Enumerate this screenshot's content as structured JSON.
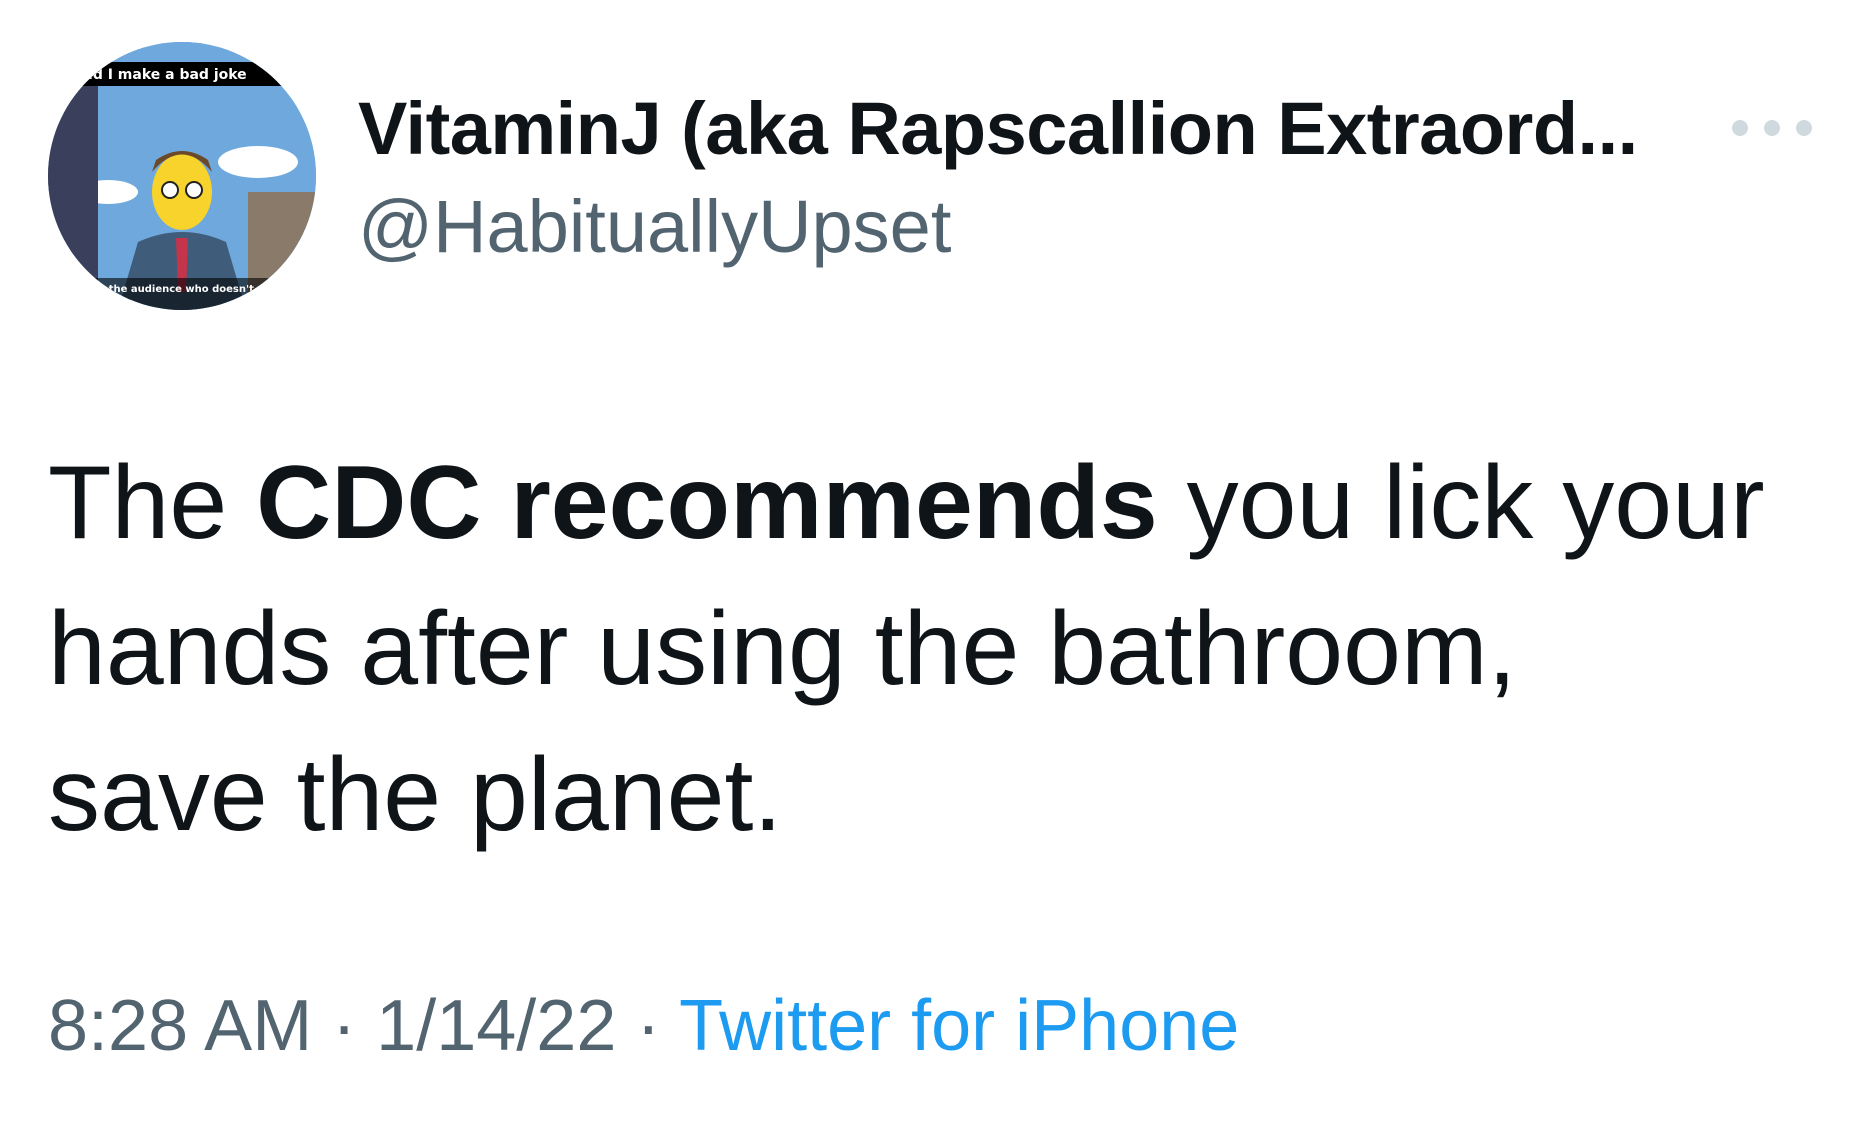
{
  "tweet": {
    "author": {
      "display_name": "VitaminJ (aka Rapscallion Extraord...",
      "handle": "@HabituallyUpset",
      "avatar_caption_top": "did I make a bad joke",
      "avatar_caption_bottom": "it's the audience who doesn't get my complex sense"
    },
    "more_icon": "ellipsis-icon",
    "text": {
      "line1_before": "The ",
      "line1_bold": "CDC recommends",
      "line1_after": " you lick your",
      "line2": "hands after using the bathroom,",
      "line3": "save the planet."
    },
    "meta": {
      "time": "8:28 AM",
      "separator": " · ",
      "date": "1/14/22",
      "source": "Twitter for iPhone"
    },
    "colors": {
      "text": "#0f1419",
      "secondary": "#536471",
      "link": "#1d9bf0"
    }
  }
}
